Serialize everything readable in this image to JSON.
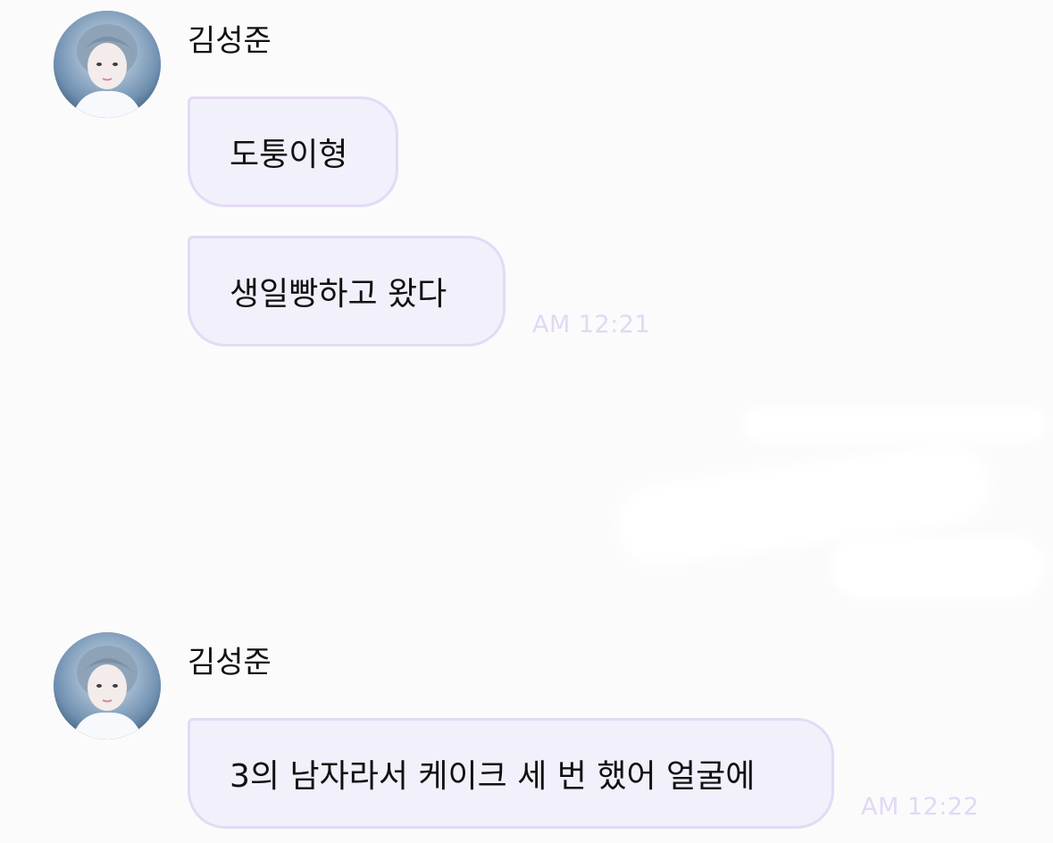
{
  "messages": [
    {
      "sender": "김성준",
      "bubbles": [
        "도퉁이형",
        "생일빵하고 왔다"
      ],
      "time": "AM 12:21"
    },
    {
      "sender": "김성준",
      "bubbles": [
        "3의 남자라서 케이크 세 번 했어 얼굴에"
      ],
      "time": "AM 12:22"
    }
  ],
  "colors": {
    "bubble_bg": "#f2f0fa",
    "bubble_border": "#e4daf5",
    "time_text": "#e2d8f4",
    "background": "#fbfbfb"
  },
  "icons": {
    "avatar": "profile-photo"
  }
}
